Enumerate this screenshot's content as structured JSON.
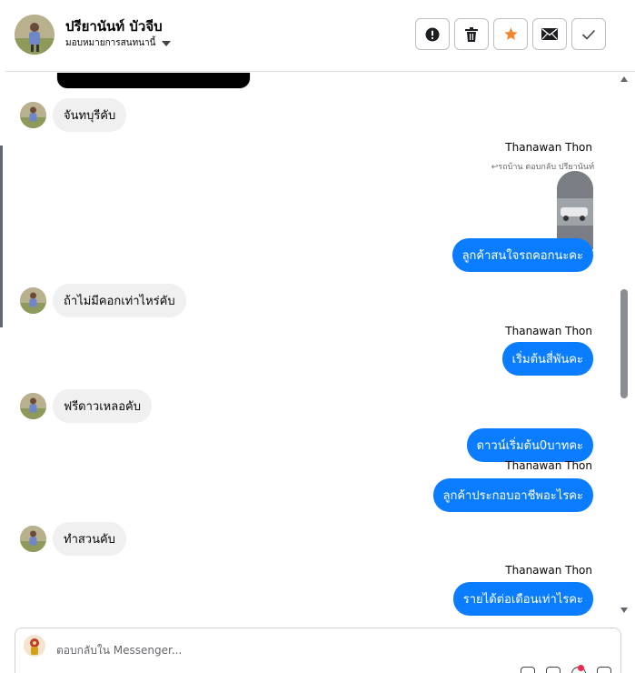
{
  "header": {
    "name": "ปรียานันท์ บัวจีบ",
    "assign_label": "มอบหมายการสนทนานี้"
  },
  "actions": [
    {
      "name": "report-button",
      "icon": "exclamation-circle-icon"
    },
    {
      "name": "delete-button",
      "icon": "trash-icon"
    },
    {
      "name": "star-button",
      "icon": "star-icon",
      "color": "#f5852a"
    },
    {
      "name": "mark-unread-button",
      "icon": "envelope-icon"
    },
    {
      "name": "mark-done-button",
      "icon": "checkmark-icon"
    }
  ],
  "messages": {
    "in_1": "จันทบุรีคับ",
    "out_1_sender": "Thanawan Thon",
    "out_1_reply": "↩รถบ้าน ตอบกลับ ปรียานันท์",
    "out_1_text": "ลูกค้าสนใจรถคอกนะคะ",
    "in_2": "ถ้าไม่มีคอกเท่าไหร่คับ",
    "out_2_sender": "Thanawan Thon",
    "out_2_text": "เริ่มต้นสี่พันคะ",
    "in_3": "ฟรีดาวเหลอคับ",
    "out_3_text": "ดาวน์เริ่มต้น0บาทคะ",
    "out_4_sender": "Thanawan Thon",
    "out_4_text": "ลูกค้าประกอบอาชีพอะไรคะ",
    "in_4": "ทำสวนคับ",
    "out_5_sender": "Thanawan Thon",
    "out_5_text": "รายได้ต่อเดือนเท่าไรคะ"
  },
  "composer": {
    "placeholder": "ตอบกลับใน Messenger..."
  },
  "colors": {
    "outgoing_bubble": "#0a7cff",
    "incoming_bubble": "#f0f0f0",
    "notification_dot": "#f02849"
  }
}
